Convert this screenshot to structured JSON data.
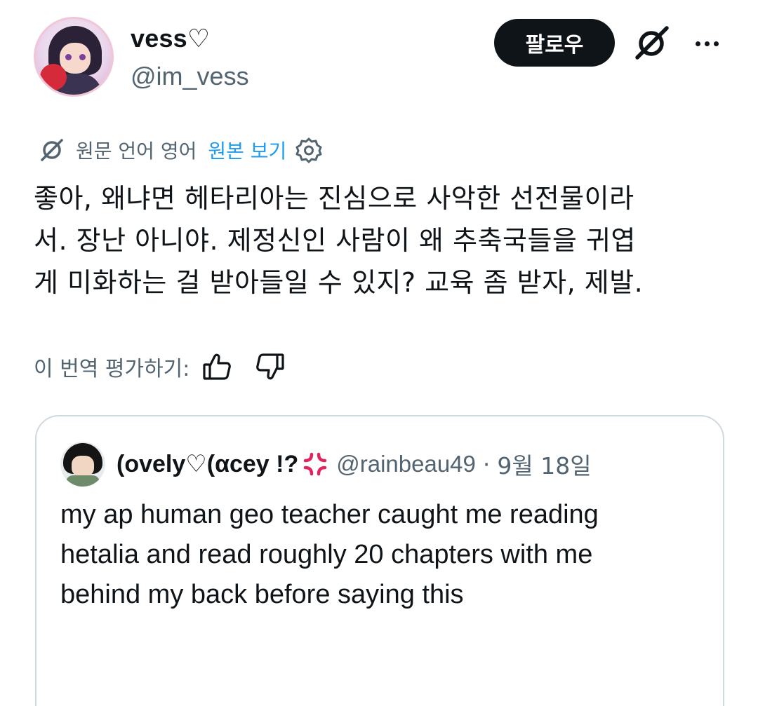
{
  "author": {
    "display_name": "vess♡",
    "handle": "@im_vess",
    "follow_label": "팔로우"
  },
  "icons": {
    "grok": "grok-icon",
    "more": "more-options-icon",
    "translate": "translate-icon",
    "settings": "settings-gear-icon",
    "thumbs_up": "thumbs-up-icon",
    "thumbs_down": "thumbs-down-icon",
    "anger": "anger-symbol-emoji"
  },
  "translation": {
    "source_language": "원문 언어 영어",
    "show_original": "원본 보기",
    "rate_label": "이 번역 평가하기:"
  },
  "tweet": {
    "lines": [
      "좋아, 왜냐면 헤타리아는 진심으로 사악한 선전물이라",
      "서. 장난 아니야. 제정신인 사람이 왜 추축국들을 귀엽",
      "게 미화하는 걸 받아들일 수 있지? 교육 좀 받자, 제발."
    ]
  },
  "quoted": {
    "display_name": "(ovely♡(αcey !?",
    "handle": "@rainbeau49",
    "separator": "·",
    "date": "9월 18일",
    "lines": [
      "my ap human geo teacher caught me reading",
      "hetalia and read roughly 20 chapters with me",
      "behind my back before saying this"
    ]
  },
  "colors": {
    "text_primary": "#0f1419",
    "text_secondary": "#536471",
    "link": "#1d9bf0",
    "border": "#cfd9de",
    "follow_bg": "#0f1419",
    "anger_red": "#e0245e"
  }
}
